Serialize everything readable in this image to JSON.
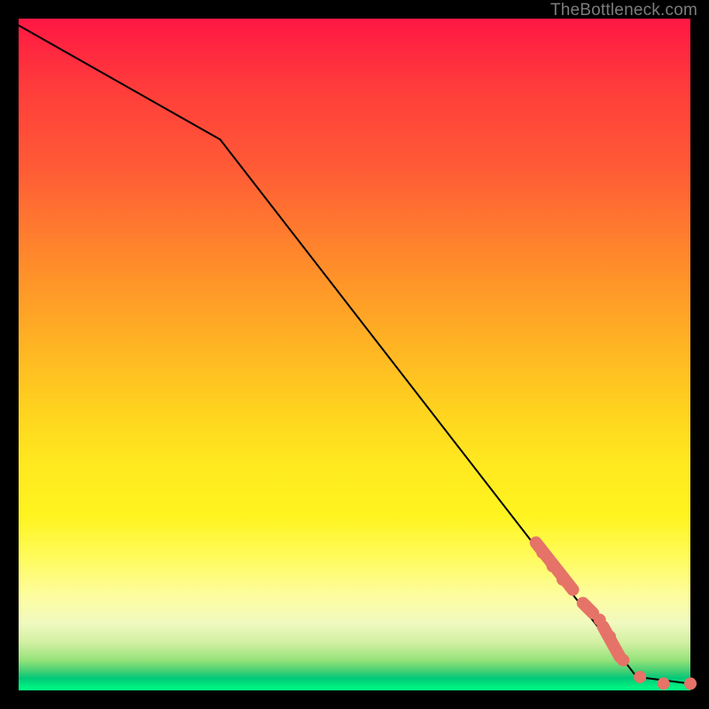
{
  "credit": "TheBottleneck.com",
  "colors": {
    "marker": "#e57368",
    "line": "#000000"
  },
  "chart_data": {
    "type": "line",
    "title": "",
    "xlabel": "",
    "ylabel": "",
    "xlim": [
      0,
      100
    ],
    "ylim": [
      0,
      100
    ],
    "grid": false,
    "series": [
      {
        "name": "curve",
        "x": [
          0,
          30,
          92,
          100
        ],
        "y": [
          99,
          82,
          2,
          1
        ],
        "note": "y guessed from vertical position in gradient; elbow at x≈30 and flat tail at bottom"
      }
    ],
    "markers": [
      {
        "x": 78,
        "y": 20.5
      },
      {
        "x": 79.5,
        "y": 18.5
      },
      {
        "x": 81,
        "y": 16.5
      },
      {
        "x": 82.5,
        "y": 15
      },
      {
        "x": 84.5,
        "y": 12.5
      },
      {
        "x": 86.5,
        "y": 10.5
      },
      {
        "x": 88,
        "y": 8
      },
      {
        "x": 90,
        "y": 4.5
      },
      {
        "x": 92.5,
        "y": 2
      },
      {
        "x": 96,
        "y": 1
      },
      {
        "x": 100,
        "y": 1
      }
    ],
    "marker_segments": [
      {
        "x1": 77,
        "y1": 22,
        "x2": 82.5,
        "y2": 15
      },
      {
        "x1": 84,
        "y1": 13,
        "x2": 85.5,
        "y2": 11.5
      },
      {
        "x1": 87,
        "y1": 9.5,
        "x2": 89.5,
        "y2": 5
      }
    ]
  }
}
